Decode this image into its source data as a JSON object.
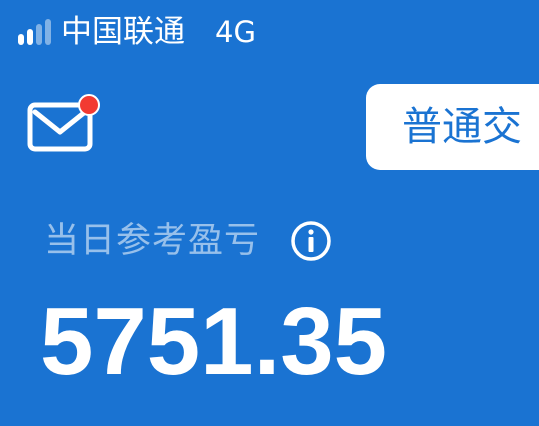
{
  "status_bar": {
    "signal_icon": "signal-bars-icon",
    "carrier": "中国联通",
    "network": "4G"
  },
  "header": {
    "mail_icon": "envelope-icon",
    "mail_has_unread": true,
    "trade_tab_label": "普通交"
  },
  "profit": {
    "label": "当日参考盈亏",
    "info_icon": "info-icon",
    "value": "5751.35"
  },
  "colors": {
    "background": "#1a73d2",
    "badge": "#f23a32",
    "tab_background": "#ffffff"
  }
}
